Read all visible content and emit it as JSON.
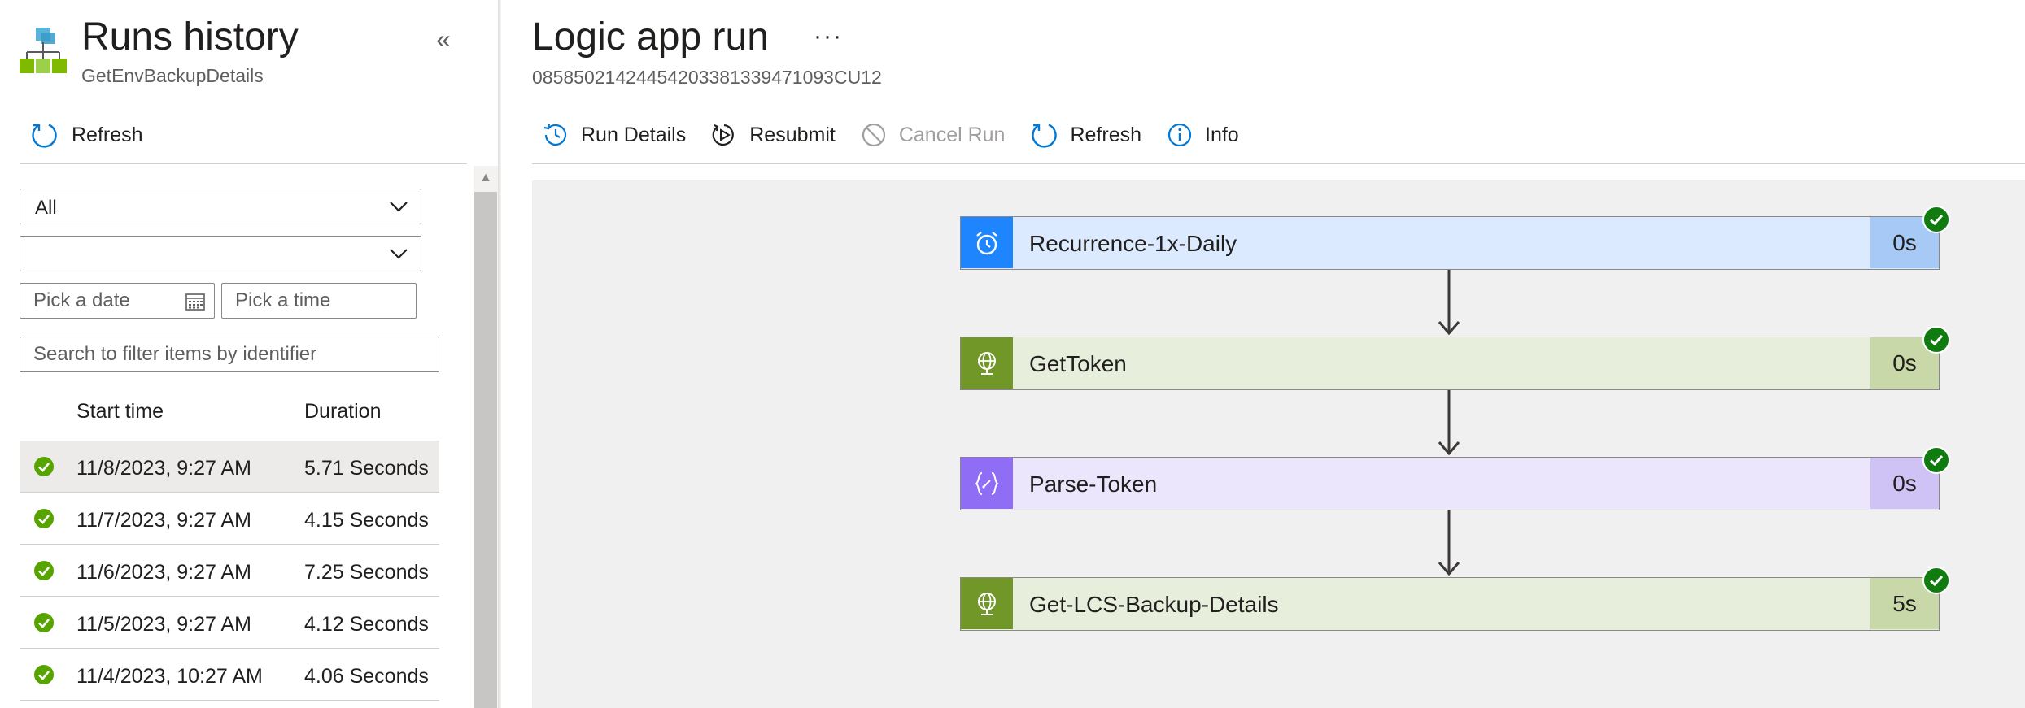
{
  "left_pane": {
    "title": "Runs history",
    "subtitle": "GetEnvBackupDetails",
    "collapse_glyph": "«",
    "refresh_label": "Refresh",
    "status_filter": {
      "value": "All"
    },
    "second_filter": {
      "value": ""
    },
    "date_input": {
      "placeholder": "Pick a date"
    },
    "time_input": {
      "placeholder": "Pick a time"
    },
    "search_input": {
      "placeholder": "Search to filter items by identifier"
    },
    "columns": {
      "start_time": "Start time",
      "duration": "Duration"
    },
    "runs": [
      {
        "start_time": "11/8/2023, 9:27 AM",
        "duration": "5.71 Seconds",
        "status": "succeeded",
        "selected": true
      },
      {
        "start_time": "11/7/2023, 9:27 AM",
        "duration": "4.15 Seconds",
        "status": "succeeded",
        "selected": false
      },
      {
        "start_time": "11/6/2023, 9:27 AM",
        "duration": "7.25 Seconds",
        "status": "succeeded",
        "selected": false
      },
      {
        "start_time": "11/5/2023, 9:27 AM",
        "duration": "4.12 Seconds",
        "status": "succeeded",
        "selected": false
      },
      {
        "start_time": "11/4/2023, 10:27 AM",
        "duration": "4.06 Seconds",
        "status": "succeeded",
        "selected": false
      }
    ]
  },
  "right_pane": {
    "title": "Logic app run",
    "more_glyph": "···",
    "run_id": "08585021424454203381339471093CU12",
    "toolbar": {
      "run_details": "Run Details",
      "resubmit": "Resubmit",
      "cancel_run": "Cancel Run",
      "refresh": "Refresh",
      "info": "Info"
    },
    "steps": [
      {
        "name": "Recurrence-1x-Daily",
        "duration": "0s",
        "icon": "alarm-clock-icon",
        "icon_bg": "#1f85ff",
        "body_bg": "#dbeafe",
        "dur_bg": "#a6caf5"
      },
      {
        "name": "GetToken",
        "duration": "0s",
        "icon": "globe-icon",
        "icon_bg": "#709727",
        "body_bg": "#e7eedb",
        "dur_bg": "#c8d8a8"
      },
      {
        "name": "Parse-Token",
        "duration": "0s",
        "icon": "json-braces-icon",
        "icon_bg": "#8f6df5",
        "body_bg": "#ebe6fc",
        "dur_bg": "#cfc3f5"
      },
      {
        "name": "Get-LCS-Backup-Details",
        "duration": "5s",
        "icon": "globe-icon",
        "icon_bg": "#709727",
        "body_bg": "#e7eedb",
        "dur_bg": "#c8d8a8"
      }
    ]
  },
  "colors": {
    "success_green": "#107c10",
    "accent_blue": "#0078d4",
    "disabled_gray": "#a19f9d",
    "canvas_bg": "#f0f0f0"
  }
}
